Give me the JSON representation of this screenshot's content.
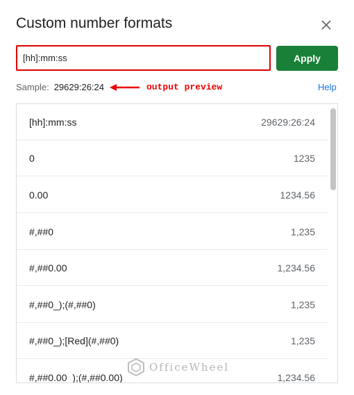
{
  "dialog": {
    "title": "Custom number formats"
  },
  "format_input": {
    "value": "[hh]:mm:ss"
  },
  "apply_label": "Apply",
  "sample": {
    "label": "Sample:",
    "value": "29629:26:24"
  },
  "annotation": {
    "text": "output preview",
    "color": "#e00000"
  },
  "help_label": "Help",
  "formats": [
    {
      "format": "[hh]:mm:ss",
      "preview": "29629:26:24"
    },
    {
      "format": "0",
      "preview": "1235"
    },
    {
      "format": "0.00",
      "preview": "1234.56"
    },
    {
      "format": "#,##0",
      "preview": "1,235"
    },
    {
      "format": "#,##0.00",
      "preview": "1,234.56"
    },
    {
      "format": "#,##0_);(#,##0)",
      "preview": "1,235"
    },
    {
      "format": "#,##0_);[Red](#,##0)",
      "preview": "1,235"
    },
    {
      "format": "#,##0.00_);(#,##0.00)",
      "preview": "1,234.56"
    }
  ],
  "watermark": {
    "text": "OfficeWheel"
  },
  "colors": {
    "apply_button": "#188038",
    "help_link": "#1a73e8",
    "input_highlight": "#dd0000"
  },
  "icons": {
    "close": "close-icon",
    "arrow": "arrow-left-icon",
    "watermark": "officewheel-logo-icon"
  }
}
